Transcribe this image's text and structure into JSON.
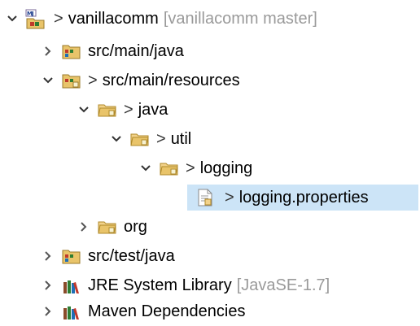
{
  "tree": {
    "project": {
      "prefix": ">",
      "name": "vanillacomm",
      "decoration": "[vanillacomm master]"
    },
    "items": [
      {
        "label": "src/main/java",
        "icon": "java-source-folder-icon"
      },
      {
        "prefix": ">",
        "label": "src/main/resources",
        "icon": "resource-folder-icon"
      },
      {
        "prefix": ">",
        "label": "java",
        "icon": "package-folder-icon"
      },
      {
        "prefix": ">",
        "label": "util",
        "icon": "package-folder-icon"
      },
      {
        "prefix": ">",
        "label": "logging",
        "icon": "package-folder-icon"
      },
      {
        "prefix": ">",
        "label": "logging.properties",
        "icon": "properties-file-icon",
        "selected": true
      },
      {
        "label": "org",
        "icon": "package-folder-icon"
      },
      {
        "label": "src/test/java",
        "icon": "java-source-folder-icon"
      },
      {
        "label": "JRE System Library",
        "decoration": "[JavaSE-1.7]",
        "icon": "library-icon"
      },
      {
        "label": "Maven Dependencies",
        "icon": "library-icon"
      }
    ]
  },
  "colors": {
    "selection": "#cce4f7",
    "decoration_text": "#9a9a9a",
    "folder": "#e9c46a",
    "chevron": "#555555"
  }
}
